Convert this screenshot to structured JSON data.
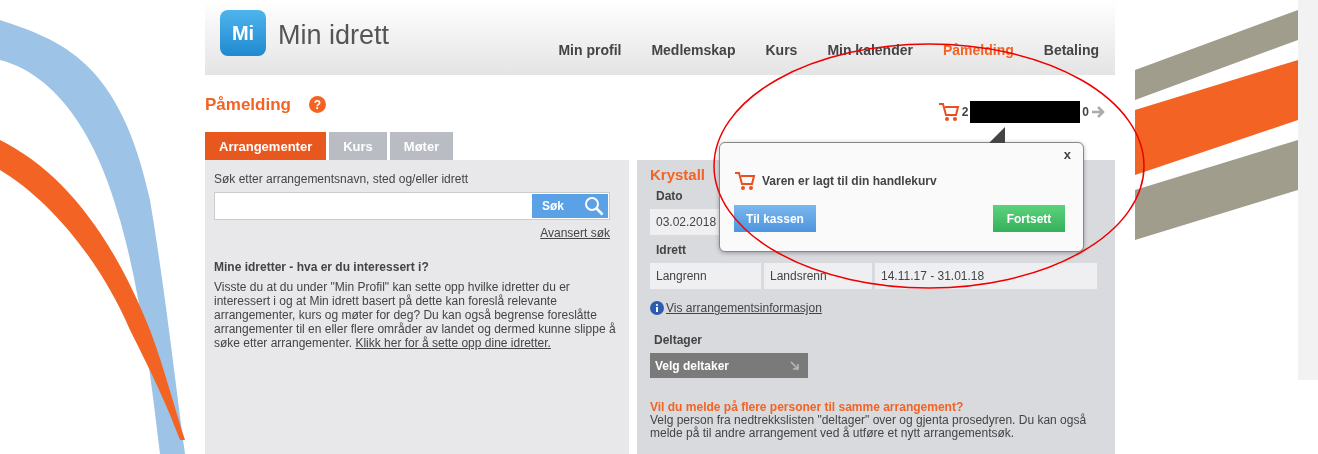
{
  "header": {
    "logo_mark": "Mi",
    "logo_text": "Min idrett",
    "nav": [
      {
        "label": "Min profil",
        "selected": false
      },
      {
        "label": "Medlemskap",
        "selected": false
      },
      {
        "label": "Kurs",
        "selected": false
      },
      {
        "label": "Min kalender",
        "selected": false
      },
      {
        "label": "Påmelding",
        "selected": true
      },
      {
        "label": "Betaling",
        "selected": false
      }
    ]
  },
  "page_title": "Påmelding",
  "help_icon": "?",
  "cart": {
    "prefix": "2",
    "suffix": "0",
    "redacted": true
  },
  "tabs": [
    {
      "label": "Arrangementer",
      "selected": true
    },
    {
      "label": "Kurs",
      "selected": false
    },
    {
      "label": "Møter",
      "selected": false
    }
  ],
  "search": {
    "label": "Søk etter arrangementsnavn, sted og/eller idrett",
    "button": "Søk",
    "advanced_link": "Avansert søk"
  },
  "interests": {
    "heading": "Mine idretter - hva er du interessert i?",
    "text": "Visste du at du under \"Min Profil\" kan sette opp hvilke idretter du er interessert i og at Min idrett basert på dette kan foreslå relevante arrangementer, kurs og møter for deg? Du kan også begrense foreslåtte arrangementer til en eller flere områder av landet og dermed kunne slippe å søke etter arrangementer.",
    "link": "Klikk her for å sette opp dine idretter."
  },
  "event": {
    "title": "Krystall",
    "rows": [
      {
        "labels": [
          "Dato"
        ],
        "values": [
          "03.02.2018"
        ]
      },
      {
        "labels": [
          "Idrett"
        ],
        "values": [
          "Langrenn",
          "Landsrenn",
          "14.11.17 - 31.01.18"
        ]
      }
    ],
    "info_link": "Vis arrangementsinformasjon",
    "participant_label": "Deltager",
    "participant_select": "Velg deltaker",
    "more_heading": "Vil du melde på flere personer til samme arrangement?",
    "more_text": "Velg person fra nedtrekkslisten \"deltager\" over og gjenta prosedyren. Du kan også melde på til andre arrangement ved å utføre et nytt arrangementsøk."
  },
  "popup": {
    "close": "x",
    "message": "Varen er lagt til din handlekurv",
    "checkout_button": "Til kassen",
    "continue_button": "Fortsett"
  },
  "annotation": {
    "highlight_circle": true
  }
}
